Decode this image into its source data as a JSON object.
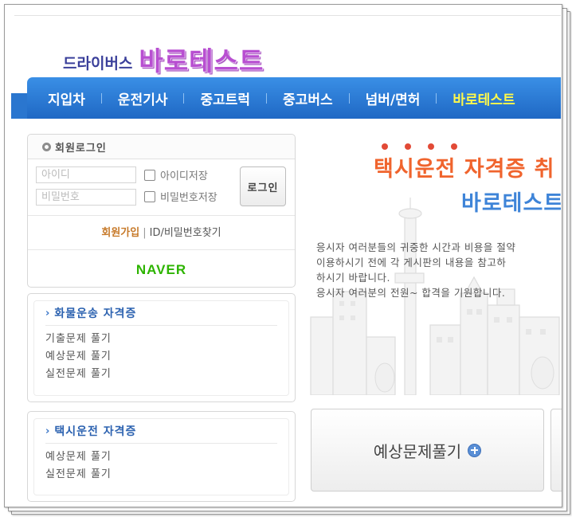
{
  "logo": {
    "sub": "드라이버스",
    "main": "바로테스트"
  },
  "nav": {
    "items": [
      {
        "label": "지입차"
      },
      {
        "label": "운전기사"
      },
      {
        "label": "중고트럭"
      },
      {
        "label": "중고버스"
      },
      {
        "label": "넘버/면허"
      },
      {
        "label": "바로테스트"
      }
    ]
  },
  "login": {
    "title": "회원로그인",
    "id_placeholder": "아이디",
    "pw_placeholder": "비밀번호",
    "save_id": "아이디저장",
    "save_pw": "비밀번호저장",
    "button": "로그인",
    "join": "회원가입",
    "separator": "|",
    "find": "ID/비밀번호찾기",
    "naver": "NAVER"
  },
  "categories": [
    {
      "title": "화물운송 자격증",
      "items": [
        "기출문제 풀기",
        "예상문제 풀기",
        "실전문제 풀기"
      ]
    },
    {
      "title": "택시운전 자격증",
      "items": [
        "예상문제 풀기",
        "실전문제 풀기"
      ]
    }
  ],
  "hero": {
    "title1": "택시운전 자격증 취",
    "title2": "바로테스트",
    "lines": [
      "응시자 여러분들의 귀중한 시간과 비용을 절약",
      "이용하시기  전에 각 게시판의 내용을 참고하",
      "하시기 바랍니다.",
      "응시자 여러분의 전원~ 합격을 기원합니다."
    ]
  },
  "action": {
    "label": "예상문제풀기",
    "icon": "plus-circle-icon"
  },
  "colors": {
    "nav": "#2a76cf",
    "highlight": "#fff94a",
    "hero_orange": "#f0642d",
    "hero_blue": "#3e84d8",
    "naver": "#2db400"
  }
}
